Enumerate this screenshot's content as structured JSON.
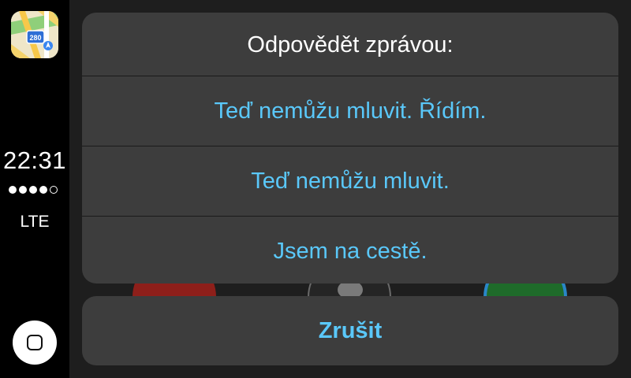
{
  "sidebar": {
    "app_icon": "maps-icon",
    "route_number": "280",
    "time": "22:31",
    "signal_bars": {
      "filled": 4,
      "total": 5
    },
    "network": "LTE",
    "home_icon": "home-button-icon"
  },
  "background_controls": [
    "decline-call-icon",
    "message-icon",
    "accept-call-icon"
  ],
  "sheet": {
    "title": "Odpovědět zprávou:",
    "options": [
      {
        "label": "Teď nemůžu mluvit. Řídím."
      },
      {
        "label": "Teď nemůžu mluvit."
      },
      {
        "label": "Jsem na cestě."
      }
    ]
  },
  "cancel_label": "Zrušit",
  "colors": {
    "accent": "#5ac8fa",
    "sheet_bg": "#3d3d3d",
    "background": "#1e1e1e",
    "sidebar_bg": "#000000"
  }
}
